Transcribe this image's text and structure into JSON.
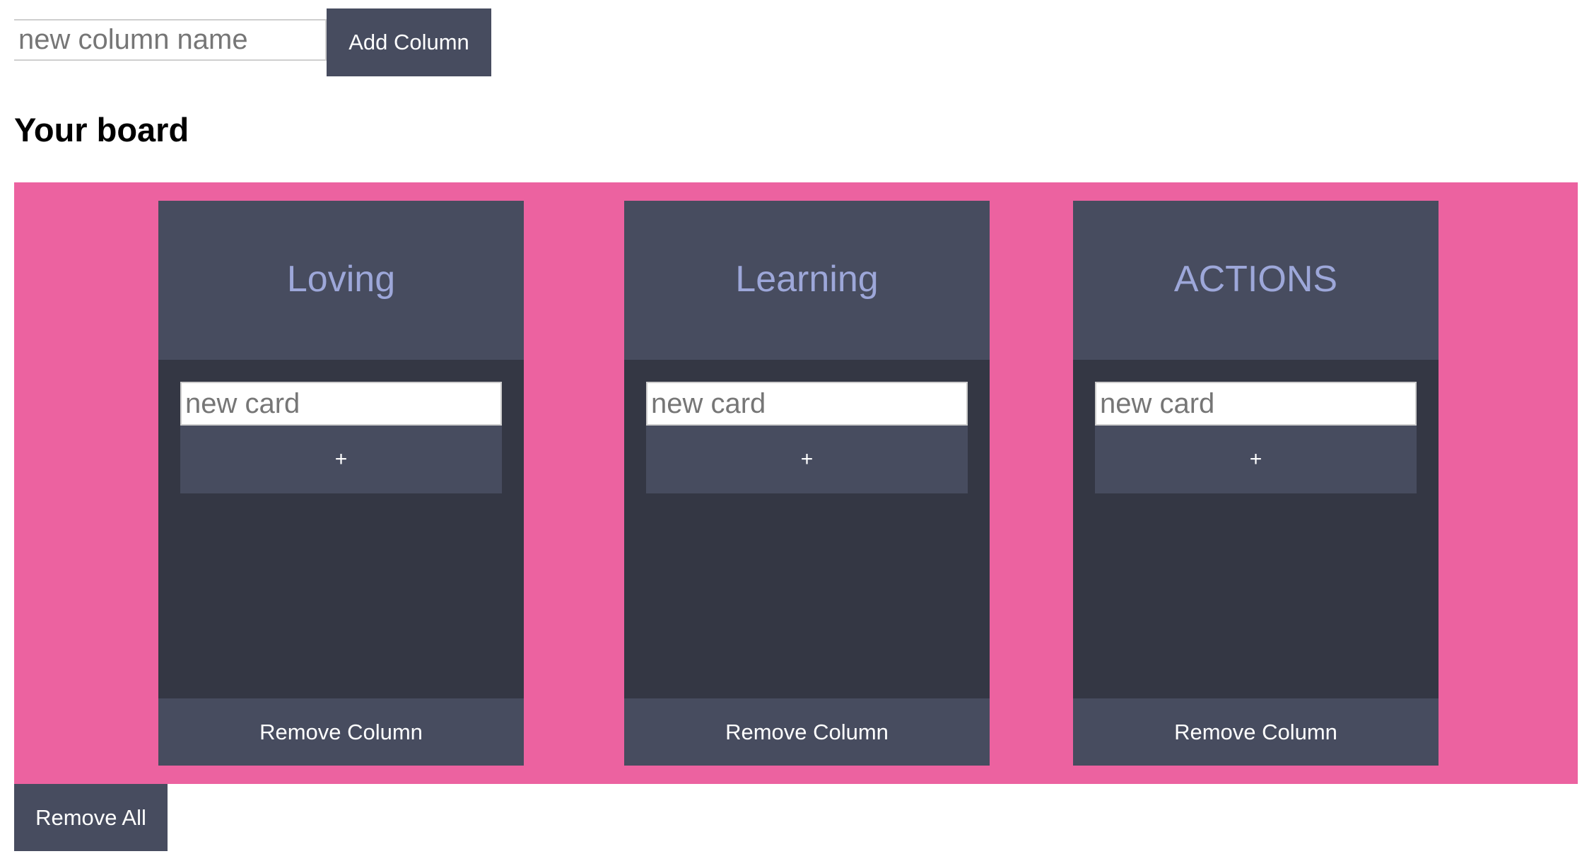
{
  "toolbar": {
    "new_column_placeholder": "new column name",
    "new_column_value": "",
    "add_column_label": "Add Column"
  },
  "board": {
    "title": "Your board",
    "columns": [
      {
        "title": "Loving",
        "card_placeholder": "new card",
        "add_card_label": "+",
        "add_card_icon": "plus-icon",
        "remove_label": "Remove Column",
        "cards": []
      },
      {
        "title": "Learning",
        "card_placeholder": "new card",
        "add_card_label": "+",
        "add_card_icon": "plus-icon",
        "remove_label": "Remove Column",
        "cards": []
      },
      {
        "title": "ACTIONS",
        "card_placeholder": "new card",
        "add_card_label": "+",
        "add_card_icon": "plus-icon",
        "remove_label": "Remove Column",
        "cards": []
      }
    ],
    "remove_all_label": "Remove All"
  },
  "colors": {
    "board_background": "#ec62a0",
    "column_header": "#474c5f",
    "column_body": "#343744",
    "column_title": "#9da7d9",
    "button_background": "#474c5f",
    "button_text": "#ffffff"
  }
}
